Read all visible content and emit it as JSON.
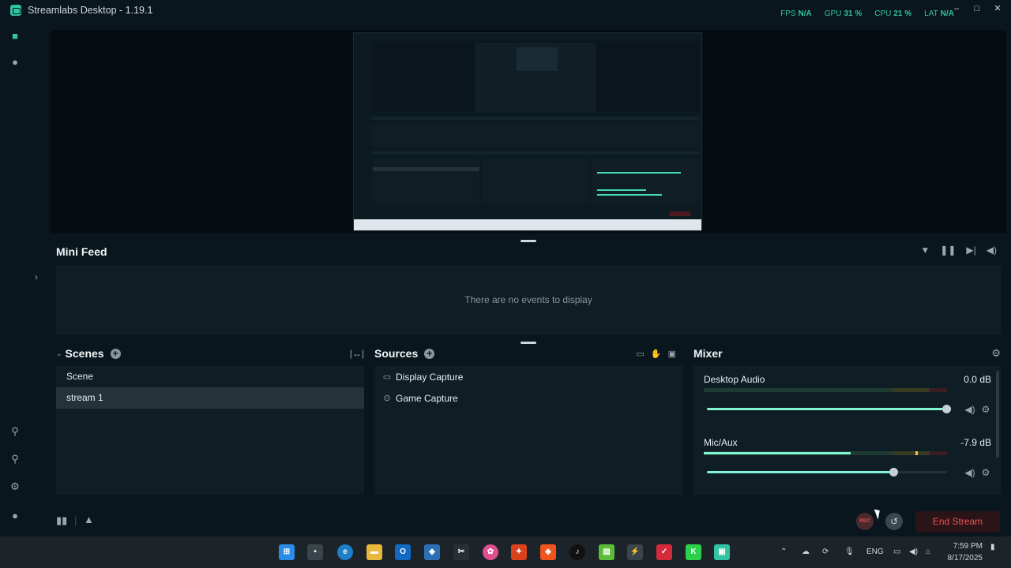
{
  "window": {
    "title": "Streamlabs Desktop - 1.19.1",
    "stats": [
      {
        "label": "FPS",
        "value": "N/A"
      },
      {
        "label": "GPU",
        "value": "31 %"
      },
      {
        "label": "CPU",
        "value": "21 %"
      },
      {
        "label": "LAT",
        "value": "N/A"
      }
    ]
  },
  "minifeed": {
    "title": "Mini Feed",
    "empty_text": "There are no events to display"
  },
  "scenes": {
    "title": "Scenes",
    "items": [
      {
        "label": "Scene",
        "selected": false
      },
      {
        "label": "stream 1",
        "selected": true
      }
    ]
  },
  "sources": {
    "title": "Sources",
    "items": [
      {
        "label": "Display Capture",
        "icon": "monitor-icon"
      },
      {
        "label": "Game Capture",
        "icon": "gamepad-icon"
      }
    ]
  },
  "mixer": {
    "title": "Mixer",
    "channels": [
      {
        "name": "Desktop Audio",
        "db": "0.0 dB",
        "level": 0.0,
        "volume": 1.0
      },
      {
        "name": "Mic/Aux",
        "db": "-7.9 dB",
        "level": 0.6,
        "volume": 0.78
      }
    ]
  },
  "footer": {
    "rec_label": "REC",
    "end_stream_label": "End Stream"
  },
  "taskbar": {
    "language": "ENG",
    "time": "7:59 PM",
    "date": "8/17/2025"
  },
  "colors": {
    "accent": "#31c3a2",
    "end_stream": "#f0505a",
    "background": "#09161d"
  }
}
